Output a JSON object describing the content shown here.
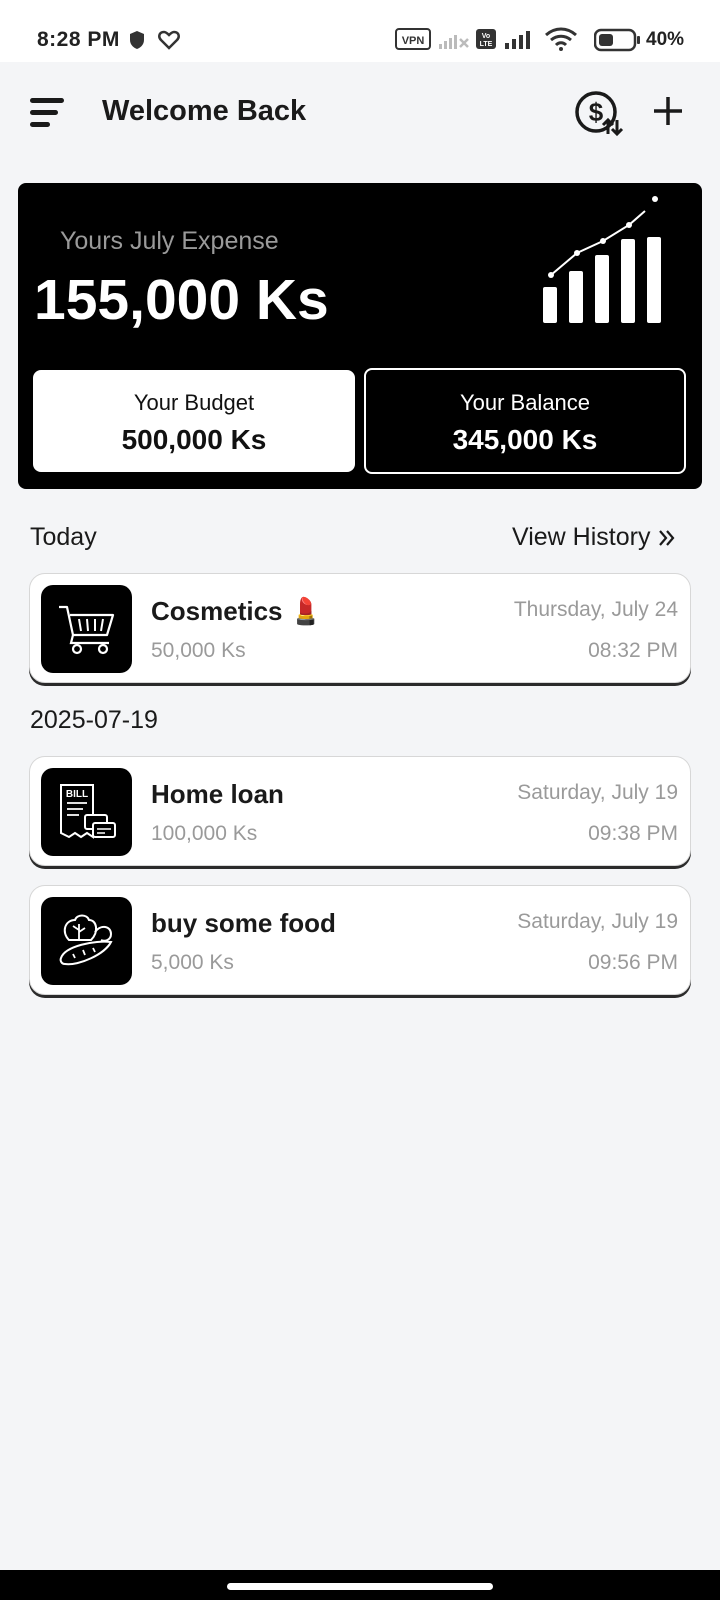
{
  "status_bar": {
    "time": "8:28 PM",
    "battery": "40%",
    "icons": [
      "shield-icon",
      "heart-icon",
      "vpn-icon",
      "signal-off-icon",
      "volte-icon",
      "signal-icon",
      "wifi-icon",
      "battery-icon"
    ]
  },
  "header": {
    "title": "Welcome Back",
    "icons": [
      "menu-icon",
      "currency-exchange-icon",
      "add-icon"
    ]
  },
  "summary": {
    "label": "Yours July Expense",
    "amount": "155,000 Ks",
    "budget_label": "Your Budget",
    "budget_value": "500,000 Ks",
    "balance_label": "Your Balance",
    "balance_value": "345,000 Ks"
  },
  "today": {
    "title": "Today",
    "view_history": "View History",
    "transactions": [
      {
        "icon": "shopping-cart-icon",
        "title": "Cosmetics",
        "emoji": "💄",
        "amount": "50,000 Ks",
        "date": "Thursday, July 24",
        "time": "08:32 PM"
      }
    ]
  },
  "group_2": {
    "title": "2025-07-19",
    "transactions": [
      {
        "icon": "bill-icon",
        "title": "Home loan",
        "amount": "100,000 Ks",
        "date": "Saturday, July 19",
        "time": "09:38 PM"
      },
      {
        "icon": "vegetables-icon",
        "title": "buy some food",
        "amount": "5,000 Ks",
        "date": "Saturday, July 19",
        "time": "09:56 PM"
      }
    ]
  },
  "bill_icon_text": "BILL",
  "colors": {
    "background": "#f4f5f7",
    "card_dark": "#000000",
    "muted_text": "#9a9a9a",
    "lipstick": "#c8323c"
  }
}
